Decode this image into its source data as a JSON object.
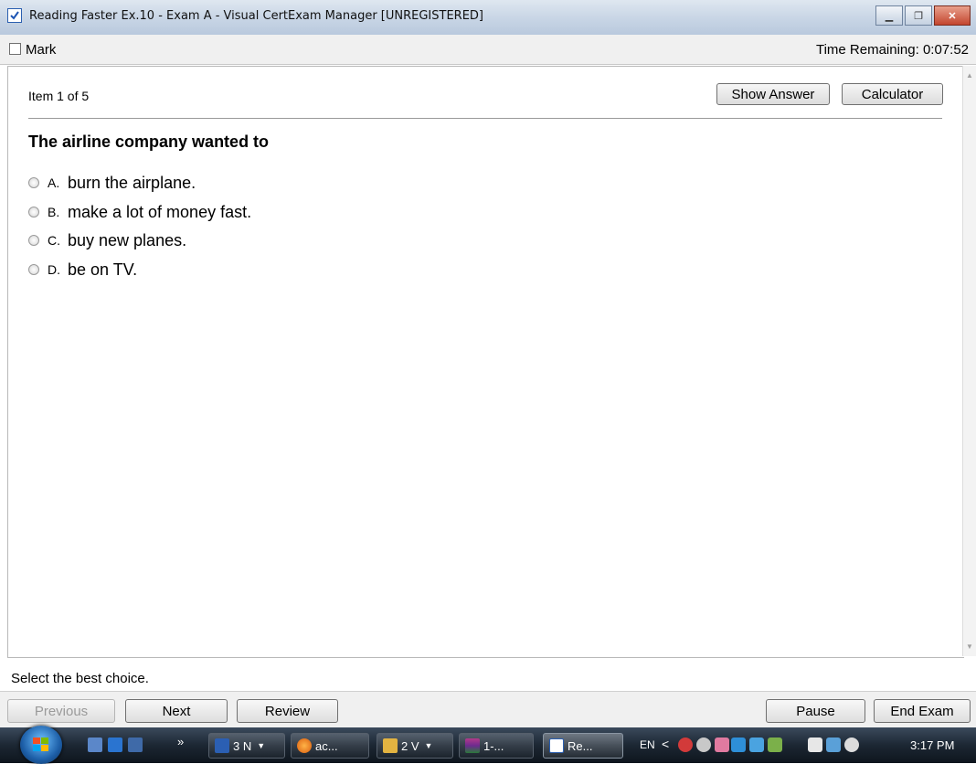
{
  "window": {
    "title": "Reading Faster Ex.10 - Exam A - Visual CertExam Manager [UNREGISTERED]"
  },
  "markbar": {
    "mark_label": "Mark",
    "time_remaining": "Time Remaining: 0:07:52"
  },
  "exam": {
    "item_counter": "Item 1 of 5",
    "show_answer_label": "Show Answer",
    "calculator_label": "Calculator",
    "question": "The airline company wanted to",
    "choices": [
      {
        "letter": "A.",
        "text": "burn the airplane."
      },
      {
        "letter": "B.",
        "text": "make a lot of money fast."
      },
      {
        "letter": "C.",
        "text": "buy new planes."
      },
      {
        "letter": "D.",
        "text": "be on TV."
      }
    ],
    "instruction": "Select the best choice."
  },
  "nav": {
    "previous_label": "Previous",
    "next_label": "Next",
    "review_label": "Review",
    "pause_label": "Pause",
    "end_exam_label": "End Exam"
  },
  "taskbar": {
    "overflow_chevron": "»",
    "items": [
      {
        "label": "3 N",
        "icon": "word-icon",
        "has_arrow": true
      },
      {
        "label": "ac...",
        "icon": "firefox-icon",
        "has_arrow": false
      },
      {
        "label": "2 V",
        "icon": "folder-icon",
        "has_arrow": true
      },
      {
        "label": "1-...",
        "icon": "archive-icon",
        "has_arrow": false
      },
      {
        "label": "Re...",
        "icon": "certexam-icon",
        "has_arrow": false
      }
    ],
    "language": "EN",
    "tray_chevron": "<",
    "clock": "3:17 PM"
  }
}
